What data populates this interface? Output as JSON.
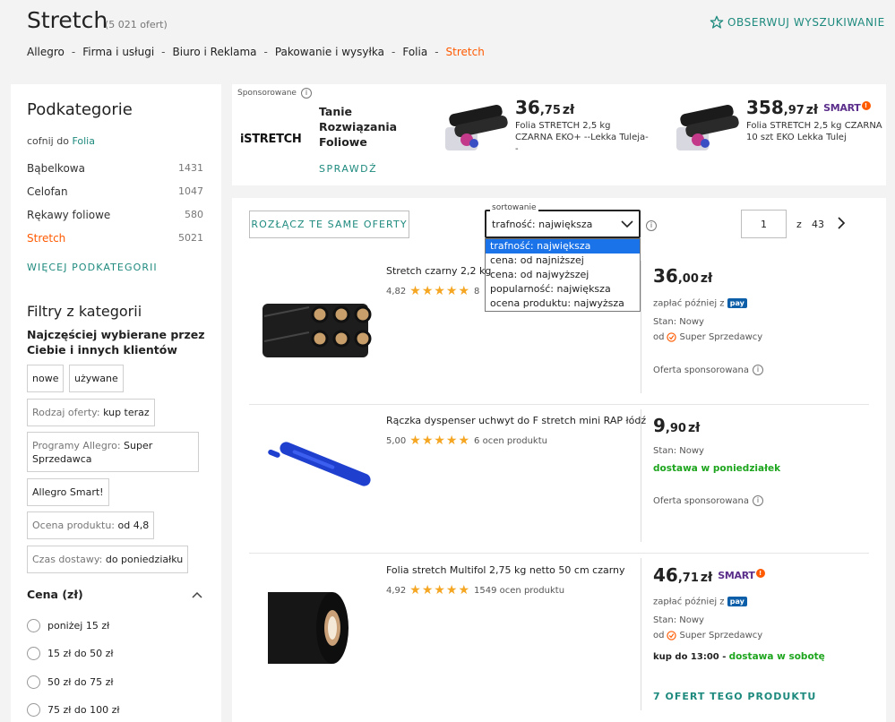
{
  "header": {
    "title": "Stretch",
    "count": "(5 021 ofert)",
    "watch_label": "OBSERWUJ WYSZUKIWANIE"
  },
  "breadcrumb": [
    "Allegro",
    "Firma i usługi",
    "Biuro i Reklama",
    "Pakowanie i wysyłka",
    "Folia",
    "Stretch"
  ],
  "sidebar": {
    "title": "Podkategorie",
    "back_prefix": "cofnij do",
    "back_link": "Folia",
    "categories": [
      {
        "label": "Bąbelkowa",
        "count": "1431"
      },
      {
        "label": "Celofan",
        "count": "1047"
      },
      {
        "label": "Rękawy foliowe",
        "count": "580"
      },
      {
        "label": "Stretch",
        "count": "5021"
      }
    ],
    "more_label": "WIĘCEJ PODKATEGORII",
    "filters_title": "Filtry z kategorii",
    "popular_title": "Najczęściej wybierane przez Ciebie i innych klientów",
    "chip_new": "nowe",
    "chip_used": "używane",
    "chip_offer_label": "Rodzaj oferty:",
    "chip_offer_value": "kup teraz",
    "chip_program_label": "Programy Allegro:",
    "chip_program_value": "Super Sprzedawca",
    "chip_smart": "Allegro Smart!",
    "chip_rating_label": "Ocena produktu:",
    "chip_rating_value": "od 4,8",
    "chip_delivery_label": "Czas dostawy:",
    "chip_delivery_value": "do poniedziałku",
    "price_title": "Cena (zł)",
    "price_ranges": [
      "poniżej 15 zł",
      "15 zł do 50 zł",
      "50 zł do 75 zł",
      "75 zł do 100 zł"
    ]
  },
  "sponsored": {
    "label": "Sponsorowane",
    "brand_logo": "iSTRETCH",
    "headline": "Tanie Rozwiązania Foliowe",
    "cta": "SPRAWDŹ",
    "items": [
      {
        "price_int": "36",
        "price_dec": ",75",
        "currency": "zł",
        "title": "Folia STRETCH 2,5 kg CZARNA EKO+ --Lekka Tuleja--"
      },
      {
        "price_int": "358",
        "price_dec": ",97",
        "currency": "zł",
        "smart": "SMART",
        "title": "Folia STRETCH 2,5 kg CZARNA 10 szt EKO Lekka Tulej"
      }
    ]
  },
  "toolbar": {
    "split_label": "ROZŁĄCZ TE SAME OFERTY",
    "sort_legend": "sortowanie",
    "sort_selected": "trafność: największa",
    "sort_options": [
      "trafność: największa",
      "cena: od najniższej",
      "cena: od najwyższej",
      "popularność: największa",
      "ocena produktu: najwyższa"
    ],
    "page_current": "1",
    "page_of": "z",
    "page_total": "43"
  },
  "products": [
    {
      "title": "Stretch czarny 2,2 kg",
      "rating": "4,82",
      "ratings_count": "8",
      "price_int": "36",
      "price_dec": ",00",
      "currency": "zł",
      "pay_later": "zapłać później z",
      "pay_badge": "pay",
      "condition": "Stan: Nowy",
      "seller_prefix": "od",
      "seller": "Super Sprzedawcy",
      "sponsored": "Oferta sponsorowana"
    },
    {
      "title": "Rączka dyspenser uchwyt do F stretch mini RAP łódź",
      "rating": "5,00",
      "ratings_count": "6 ocen produktu",
      "price_int": "9",
      "price_dec": ",90",
      "currency": "zł",
      "condition": "Stan: Nowy",
      "delivery": "dostawa w poniedziałek",
      "sponsored": "Oferta sponsorowana"
    },
    {
      "title": "Folia stretch Multifol 2,75 kg netto 50 cm czarny",
      "rating": "4,92",
      "ratings_count": "1549 ocen produktu",
      "price_int": "46",
      "price_dec": ",71",
      "currency": "zł",
      "smart": "SMART",
      "pay_later": "zapłać później z",
      "pay_badge": "pay",
      "condition": "Stan: Nowy",
      "seller_prefix": "od",
      "seller": "Super Sprzedawcy",
      "delivery_time": "kup do 13:00 -",
      "delivery": "dostawa w sobotę",
      "more_offers": "7 OFERT TEGO PRODUKTU"
    }
  ],
  "colors": {
    "accent": "#1e8a7e",
    "brand": "#ff5a00",
    "selection": "#1a73e8",
    "smart": "#5a2e8a",
    "delivery": "#1ea51e"
  }
}
